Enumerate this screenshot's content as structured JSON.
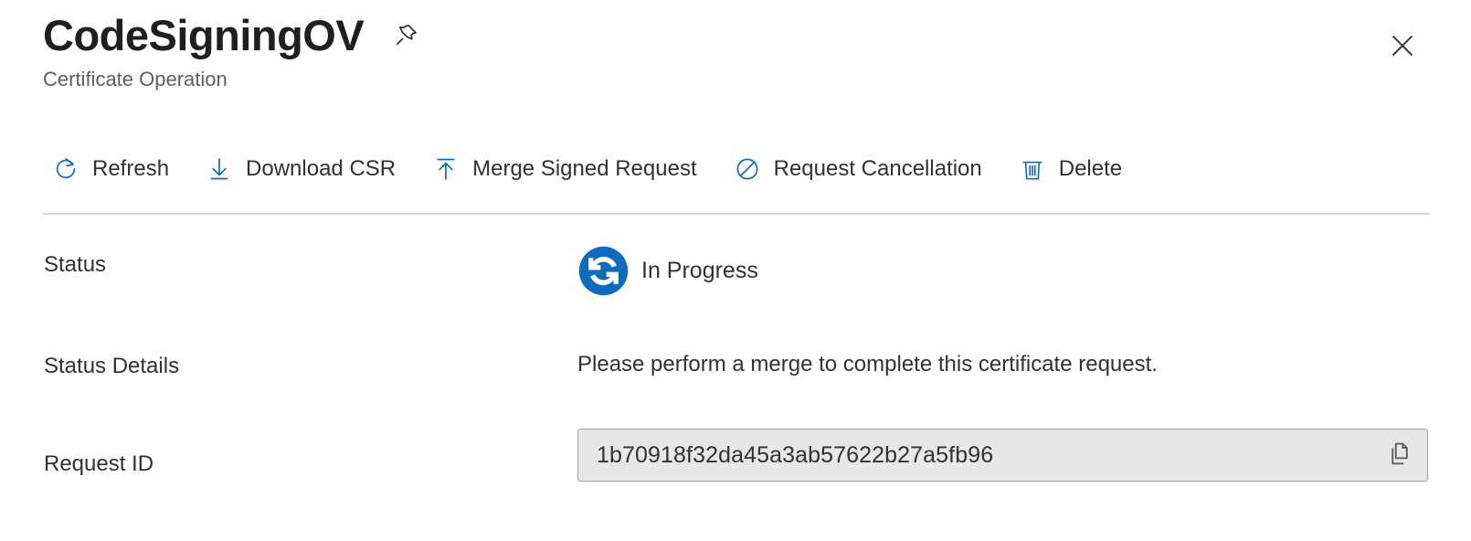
{
  "header": {
    "title": "CodeSigningOV",
    "subtitle": "Certificate Operation",
    "pin_icon": "pin-icon",
    "close_icon": "close-icon"
  },
  "colors": {
    "accent_blue": "#0f6cbd",
    "status_blue": "#0f6cbd",
    "text": "#323130",
    "subtitle": "#605e5c",
    "divider": "#d6d6d6",
    "field_background": "#e7e7e7",
    "field_border": "#a19f9d"
  },
  "command_bar": {
    "items": [
      {
        "label": "Refresh",
        "icon": "refresh-icon"
      },
      {
        "label": "Download CSR",
        "icon": "download-icon"
      },
      {
        "label": "Merge Signed Request",
        "icon": "upload-icon"
      },
      {
        "label": "Request Cancellation",
        "icon": "block-icon"
      },
      {
        "label": "Delete",
        "icon": "trash-icon"
      }
    ]
  },
  "properties": {
    "status": {
      "label": "Status",
      "value": "In Progress",
      "icon": "sync-in-progress-icon"
    },
    "status_details": {
      "label": "Status Details",
      "value": "Please perform a merge to complete this certificate request."
    },
    "request_id": {
      "label": "Request ID",
      "value": "1b70918f32da45a3ab57622b27a5fb96",
      "copy_icon": "copy-icon"
    }
  }
}
